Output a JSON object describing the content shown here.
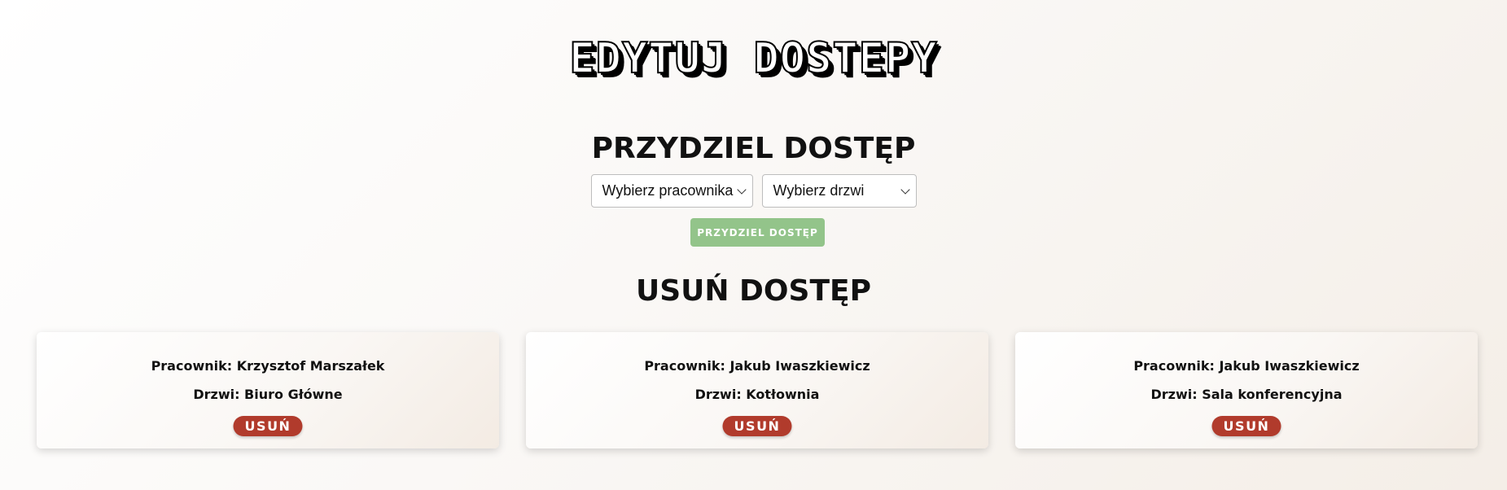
{
  "page": {
    "title": "EDYTUJ DOSTEPY"
  },
  "assign": {
    "heading": "PRZYDZIEL DOSTĘP",
    "employee_select": {
      "selected": "Wybierz pracownika"
    },
    "door_select": {
      "selected": "Wybierz drzwi"
    },
    "button_label": "PRZYDZIEL DOSTĘP",
    "button_color": "#93c48a"
  },
  "remove": {
    "heading": "USUŃ DOSTĘP",
    "button_color": "#b13b2c",
    "cards": [
      {
        "employee": "Pracownik: Krzysztof Marszałek",
        "door": "Drzwi: Biuro Główne",
        "button_label": "USUŃ"
      },
      {
        "employee": "Pracownik: Jakub Iwaszkiewicz",
        "door": "Drzwi: Kotłownia",
        "button_label": "USUŃ"
      },
      {
        "employee": "Pracownik: Jakub Iwaszkiewicz",
        "door": "Drzwi: Sala konferencyjna",
        "button_label": "USUŃ"
      }
    ]
  }
}
